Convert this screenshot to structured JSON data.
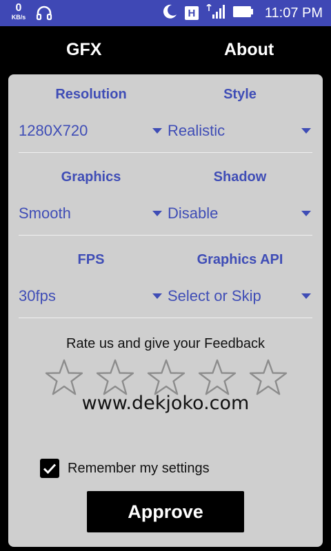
{
  "status_bar": {
    "speed_value": "0",
    "speed_unit": "KB/s",
    "time": "11:07 PM",
    "badge_letter": "H",
    "icons": [
      "headphone-icon",
      "moon-icon",
      "hd-badge-icon",
      "signal-icon",
      "battery-icon"
    ]
  },
  "tabs": [
    {
      "label": "GFX"
    },
    {
      "label": "About"
    }
  ],
  "settings": [
    {
      "label": "Resolution",
      "value": "1280X720"
    },
    {
      "label": "Style",
      "value": "Realistic"
    },
    {
      "label": "Graphics",
      "value": "Smooth"
    },
    {
      "label": "Shadow",
      "value": "Disable"
    },
    {
      "label": "FPS",
      "value": "30fps"
    },
    {
      "label": "Graphics API",
      "value": "Select or Skip"
    }
  ],
  "feedback": {
    "prompt": "Rate us and give your Feedback",
    "stars_total": 5,
    "stars_selected": 0
  },
  "watermark": "www.dekjoko.com",
  "remember": {
    "label": "Remember my settings",
    "checked": true
  },
  "approve_label": "Approve",
  "colors": {
    "status_bar": "#3f48b5",
    "accent_text": "#3f4db6",
    "card_bg": "#cfcfcf",
    "screen_bg": "#000000"
  }
}
